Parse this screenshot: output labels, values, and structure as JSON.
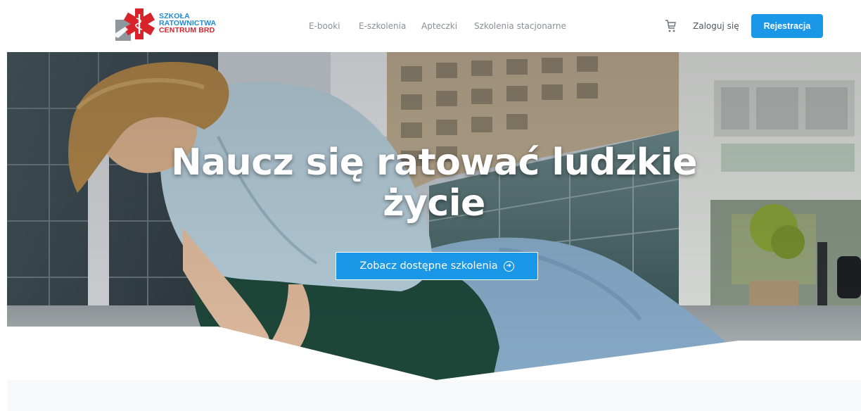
{
  "header": {
    "logo": {
      "line1": "SZKOŁA",
      "line2": "RATOWNICTWA",
      "line3": "CENTRUM BRD",
      "colors": {
        "blue": "#1f8ad6",
        "red": "#d8232a"
      }
    },
    "nav": [
      {
        "label": "E-booki"
      },
      {
        "label": "E-szkolenia"
      },
      {
        "label": "Apteczki"
      },
      {
        "label": "Szkolenia stacjonarne"
      }
    ],
    "cart_icon": "shopping-cart-icon",
    "login_label": "Zaloguj się",
    "register_label": "Rejestracja",
    "accent_color": "#1a97e6"
  },
  "hero": {
    "title_line1": "Naucz się ratować ludzkie",
    "title_line2": "życie",
    "cta_label": "Zobacz dostępne szkolenia",
    "cta_icon": "arrow-circle-right-icon"
  }
}
